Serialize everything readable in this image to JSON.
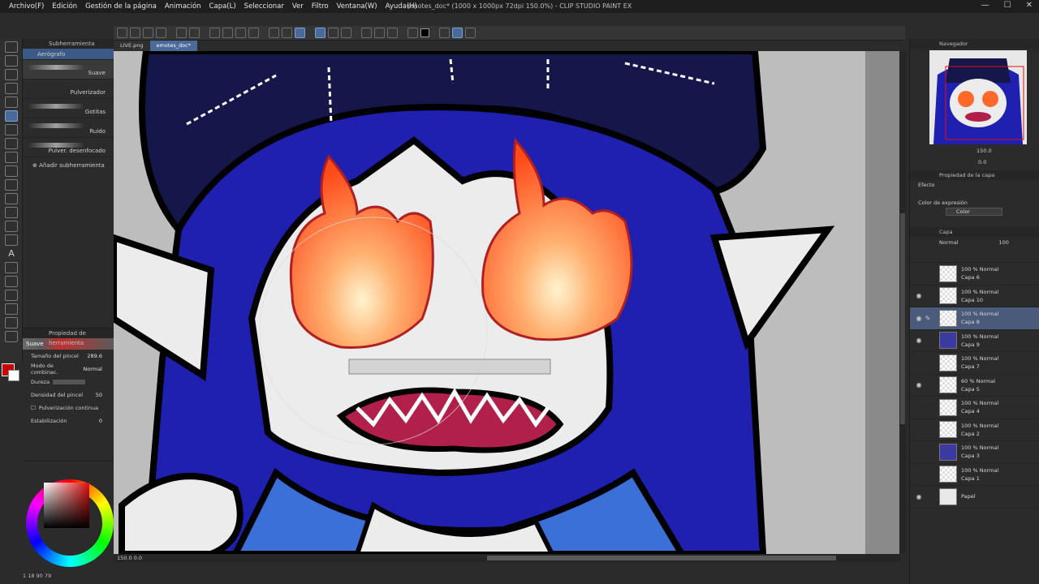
{
  "window": {
    "title": "emotes_doc* (1000 x 1000px 72dpi 150.0%) - CLIP STUDIO PAINT EX",
    "controls": [
      "—",
      "☐",
      "✕"
    ]
  },
  "menu": [
    "Archivo(F)",
    "Edición",
    "Gestión de la página",
    "Animación",
    "Capa(L)",
    "Seleccionar",
    "Ver",
    "Filtro",
    "Ventana(W)",
    "Ayuda(H)"
  ],
  "tabs": [
    "LIVE.png",
    "emotes_doc*"
  ],
  "subtool": {
    "panel_title": "Subherramienta",
    "group": "Aerógrafo",
    "items": [
      "Suave",
      "Pulverizador",
      "Gotitas",
      "Ruido",
      "Pulver. desenfocado"
    ],
    "add_label": "Añadir subherramienta"
  },
  "tool_property": {
    "panel_title": "Propiedad de herramienta",
    "brush_name": "Suave",
    "rows": [
      {
        "label": "Tamaño del pincel",
        "value": "289.6"
      },
      {
        "label": "Modo de combinac.",
        "value": "Normal"
      },
      {
        "label": "Dureza",
        "value": ""
      },
      {
        "label": "Densidad del pincel",
        "value": "50"
      },
      {
        "label": "Pulverización continua",
        "value": ""
      },
      {
        "label": "Estabilización",
        "value": "0"
      }
    ]
  },
  "color": {
    "main": "#c80000",
    "sub": "#ffffff",
    "footer": "1 18 90 79"
  },
  "canvas": {
    "zoom": "150.0",
    "angle": "0.0"
  },
  "navigator": {
    "panel_title": "Navegador",
    "zoom": "150.0",
    "angle": "0.0"
  },
  "layer_property": {
    "panel_title": "Propiedad de la capa",
    "efecto_label": "Efecto",
    "expression_label": "Color de expresión",
    "expression_value": "Color"
  },
  "layers": {
    "panel_title": "Capa",
    "blend": "Normal",
    "opacity": "100",
    "rows": [
      {
        "mode": "100 % Normal",
        "name": "Capa 6",
        "visible": false,
        "selected": false,
        "thumb": "transparent"
      },
      {
        "mode": "100 % Normal",
        "name": "Capa 10",
        "visible": true,
        "selected": false,
        "thumb": "transparent"
      },
      {
        "mode": "100 % Normal",
        "name": "Capa 8",
        "visible": true,
        "selected": true,
        "thumb": "transparent"
      },
      {
        "mode": "100 % Normal",
        "name": "Capa 9",
        "visible": true,
        "selected": false,
        "thumb": "char"
      },
      {
        "mode": "100 % Normal",
        "name": "Capa 7",
        "visible": false,
        "selected": false,
        "thumb": "transparent"
      },
      {
        "mode": "60 % Normal",
        "name": "Capa 5",
        "visible": true,
        "selected": false,
        "thumb": "transparent"
      },
      {
        "mode": "100 % Normal",
        "name": "Capa 4",
        "visible": false,
        "selected": false,
        "thumb": "transparent"
      },
      {
        "mode": "100 % Normal",
        "name": "Capa 2",
        "visible": false,
        "selected": false,
        "thumb": "transparent"
      },
      {
        "mode": "100 % Normal",
        "name": "Capa 3",
        "visible": false,
        "selected": false,
        "thumb": "char"
      },
      {
        "mode": "100 % Normal",
        "name": "Capa 1",
        "visible": false,
        "selected": false,
        "thumb": "transparent"
      },
      {
        "mode": "",
        "name": "Papel",
        "visible": true,
        "selected": false,
        "thumb": "paper"
      }
    ]
  },
  "colors": {
    "accent": "#4a6a9a",
    "hair": "#1f1fb0",
    "hat": "#15164a",
    "fire": "#ff6a2a"
  }
}
